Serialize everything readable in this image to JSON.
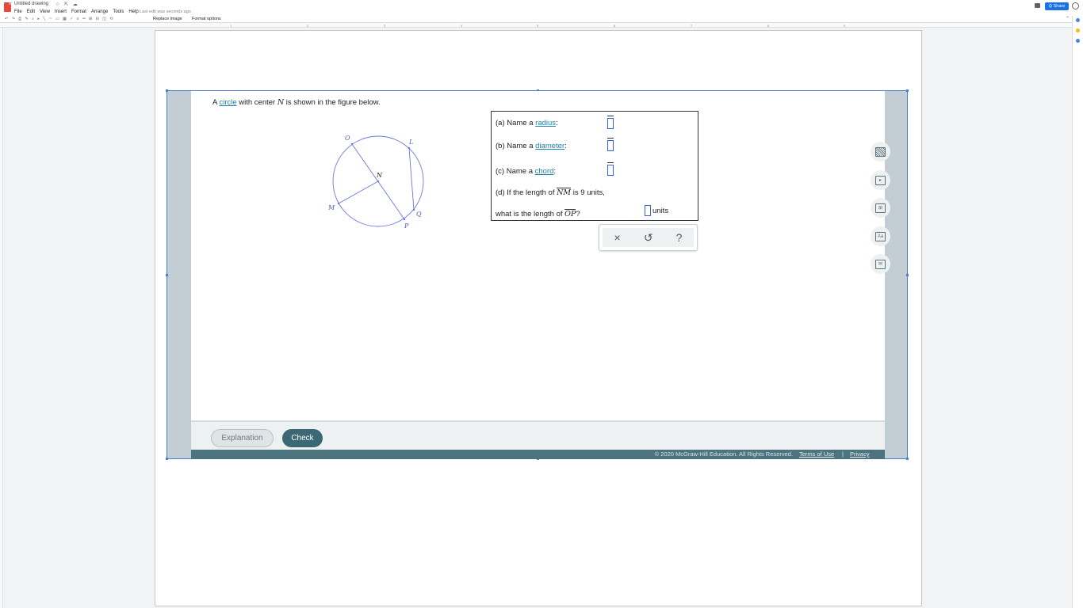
{
  "app": {
    "doc_title": "Untitled drawing",
    "last_edit": "Last edit was seconds ago",
    "menu": [
      "File",
      "Edit",
      "View",
      "Insert",
      "Format",
      "Arrange",
      "Tools",
      "Help"
    ],
    "share_label": "Share",
    "toolbar": {
      "replace_image": "Replace image",
      "format_options": "Format options"
    },
    "ruler_ticks": [
      "1",
      "2",
      "3",
      "4",
      "5",
      "6",
      "7",
      "8",
      "9"
    ]
  },
  "problem": {
    "prompt_prefix": "A ",
    "prompt_link": "circle",
    "prompt_middle": " with center ",
    "prompt_center": "N",
    "prompt_suffix": " is shown in the figure below.",
    "figure_labels": {
      "O": "O",
      "L": "L",
      "N": "N",
      "M": "M",
      "Q": "Q",
      "P": "P"
    },
    "questions": {
      "a_prefix": "(a) Name a ",
      "a_link": "radius",
      "a_suffix": ":",
      "b_prefix": "(b) Name a ",
      "b_link": "diameter",
      "b_suffix": ":",
      "c_prefix": "(c) Name a ",
      "c_link": "chord",
      "c_suffix": ":",
      "d_line1_prefix": "(d) If the length of ",
      "d_line1_seg": "NM",
      "d_line1_suffix": " is 9 units,",
      "d_line2_prefix": "what is the length of ",
      "d_line2_seg": "OP",
      "d_line2_suffix": "?",
      "units": "units"
    },
    "keypad": {
      "clear": "×",
      "undo": "↺",
      "help": "?"
    },
    "buttons": {
      "explanation": "Explanation",
      "check": "Check"
    },
    "footer": {
      "copyright": "© 2020 McGraw-Hill Education. All Rights Reserved.",
      "terms": "Terms of Use",
      "separator": "|",
      "privacy": "Privacy"
    },
    "tool_icons": [
      "calculator-icon",
      "video-icon",
      "textbook-icon",
      "glossary-icon",
      "message-icon"
    ],
    "glossary_glyph": "Aa"
  },
  "colors": {
    "link": "#1b84a5",
    "check_button": "#3c6775",
    "footer": "#4d737f",
    "circle": "#6b78e0",
    "share": "#1a73e8"
  }
}
